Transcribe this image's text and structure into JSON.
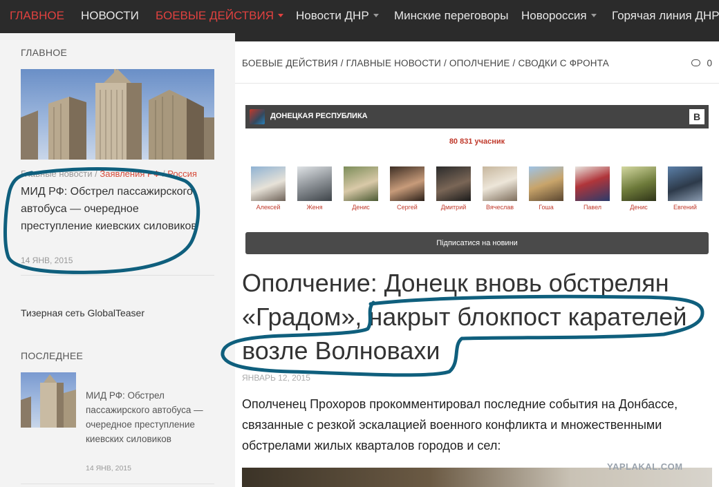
{
  "nav": {
    "items": [
      {
        "label": "ГЛАВНОЕ",
        "active": true
      },
      {
        "label": "НОВОСТИ"
      },
      {
        "label": "БОЕВЫЕ ДЕЙСТВИЯ"
      },
      {
        "label": "Новости ДНР"
      },
      {
        "label": "Минские переговоры"
      },
      {
        "label": "Новороссия"
      },
      {
        "label": "Горячая линия ДНР"
      }
    ]
  },
  "sidebar": {
    "main_title": "ГЛАВНОЕ",
    "hero": {
      "cat1": "Главные новости",
      "sep1": " / ",
      "cat2": "Заявления РФ",
      "sep2": " / ",
      "cat3": "Россия",
      "title": "МИД РФ: Обстрел пассажирского автобуса — очередное преступление киевских силовиков",
      "date": "14 ЯНВ, 2015"
    },
    "teaser": "Тизерная сеть GlobalTeaser",
    "latest_title": "ПОСЛЕДНЕЕ",
    "latest": {
      "title": "МИД РФ: Обстрел пассажирского автобуса — очередное преступление киевских силовиков",
      "date": "14 ЯНВ, 2015"
    }
  },
  "main": {
    "breadcrumb": "БОЕВЫЕ ДЕЙСТВИЯ / ГЛАВНЫЕ НОВОСТИ / ОПОЛЧЕНИЕ / СВОДКИ С ФРОНТА",
    "comment_count": "0",
    "vk": {
      "name": "ДОНЕЦКАЯ РЕСПУБЛИКА",
      "badge": "В",
      "members_count": "80 831 учасник",
      "members": [
        "Алексей",
        "Женя",
        "Денис",
        "Сергей",
        "Дмитрий",
        "Вячеслав",
        "Гоша",
        "Павел",
        "Денис",
        "Евгений"
      ],
      "subscribe": "Підписатися на новини"
    },
    "article": {
      "title": "Ополчение: Донецк вновь обстрелян «Градом», накрыт блокпост карателей возле Волновахи",
      "date": "ЯНВАРЬ 12, 2015",
      "body": "Ополченец Прохоров прокомментировал последние события на Донбассе, связанные с резкой эскалацией военного конфликта и множественными обстрелами жилых кварталов городов и сел:"
    }
  },
  "watermark": "YAPLAKAL.COM",
  "colors": {
    "accent": "#e0413f",
    "nav_bg": "#2b2b2b",
    "marker": "#0f5f7d"
  }
}
